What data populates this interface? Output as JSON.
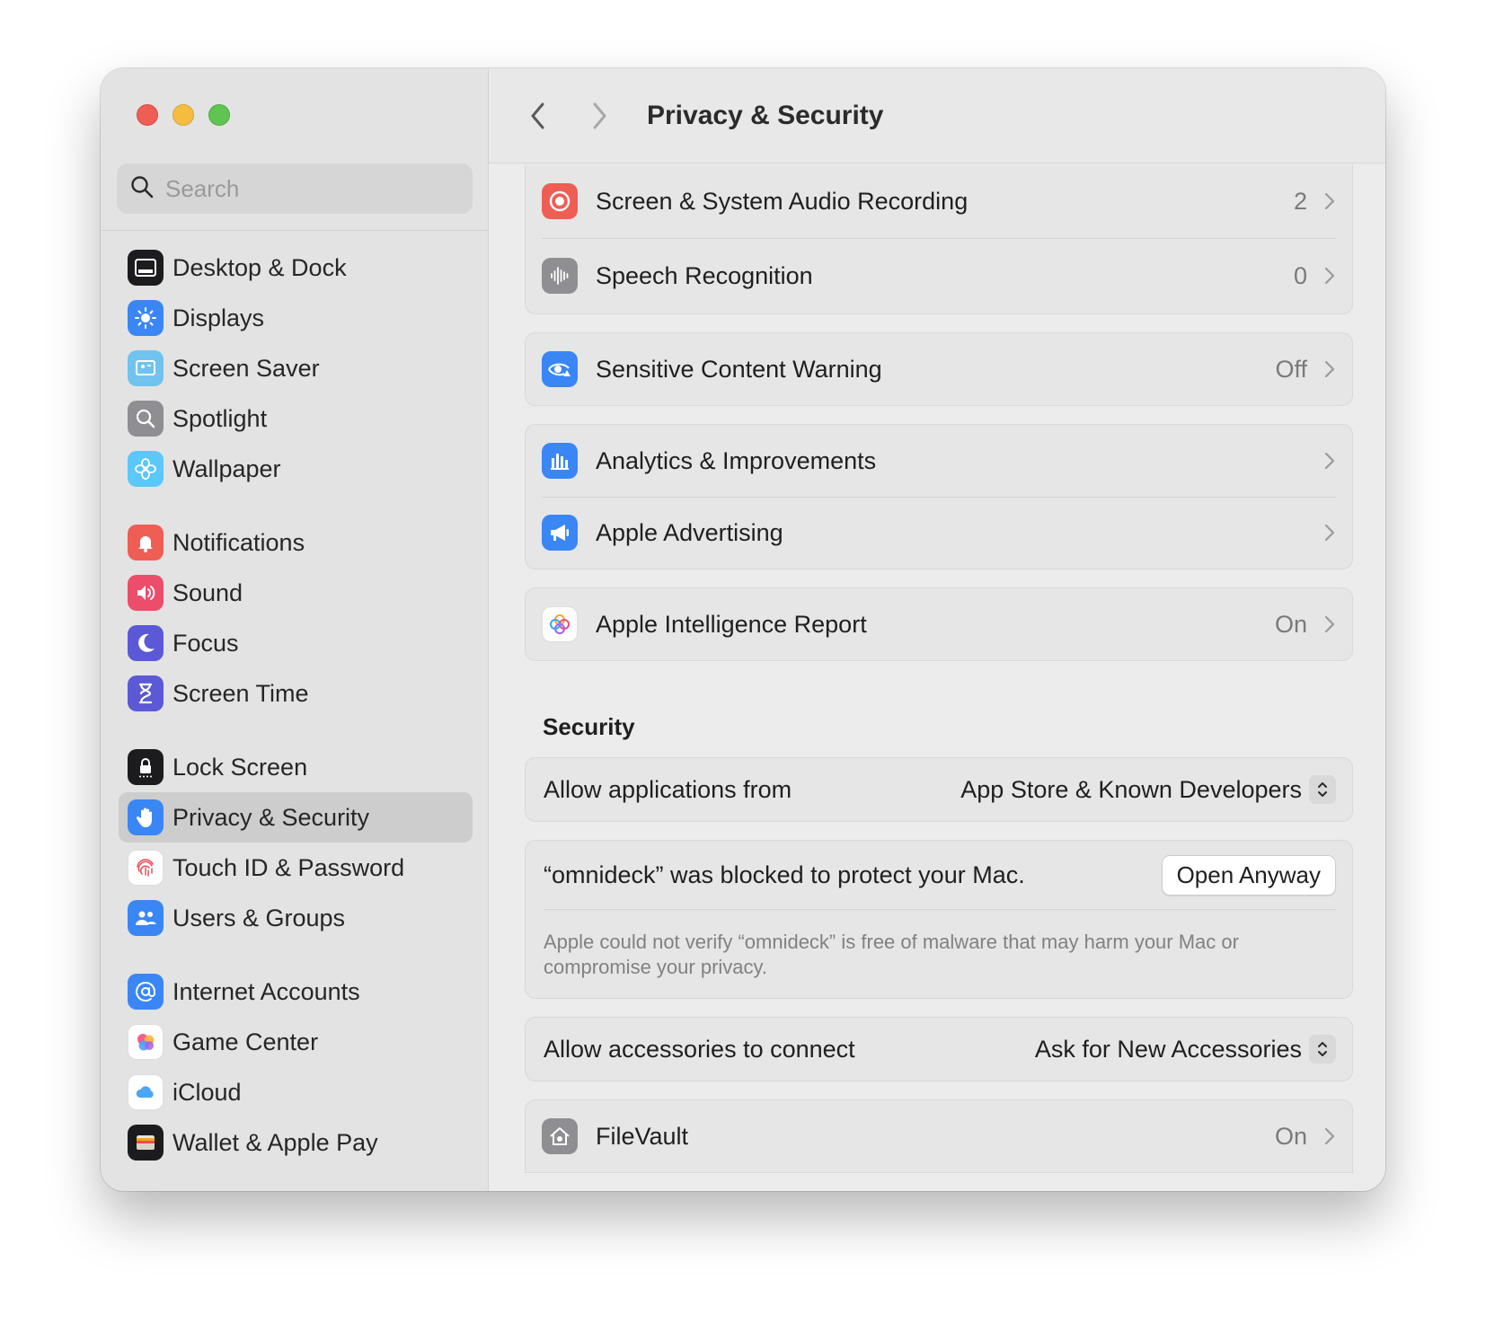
{
  "window": {
    "title": "Privacy & Security"
  },
  "search": {
    "placeholder": "Search"
  },
  "sidebar": {
    "groups": [
      [
        {
          "label": "Desktop & Dock",
          "icon": "dock-icon"
        },
        {
          "label": "Displays",
          "icon": "sun-icon"
        },
        {
          "label": "Screen Saver",
          "icon": "screen-saver-icon"
        },
        {
          "label": "Spotlight",
          "icon": "magnifier-icon"
        },
        {
          "label": "Wallpaper",
          "icon": "flower-icon"
        }
      ],
      [
        {
          "label": "Notifications",
          "icon": "bell-icon"
        },
        {
          "label": "Sound",
          "icon": "speaker-icon"
        },
        {
          "label": "Focus",
          "icon": "moon-icon"
        },
        {
          "label": "Screen Time",
          "icon": "hourglass-icon"
        }
      ],
      [
        {
          "label": "Lock Screen",
          "icon": "lock-icon"
        },
        {
          "label": "Privacy & Security",
          "icon": "hand-icon",
          "selected": true
        },
        {
          "label": "Touch ID & Password",
          "icon": "fingerprint-icon"
        },
        {
          "label": "Users & Groups",
          "icon": "users-icon"
        }
      ],
      [
        {
          "label": "Internet Accounts",
          "icon": "at-icon"
        },
        {
          "label": "Game Center",
          "icon": "game-center-icon"
        },
        {
          "label": "iCloud",
          "icon": "cloud-icon"
        },
        {
          "label": "Wallet & Apple Pay",
          "icon": "wallet-icon"
        }
      ]
    ]
  },
  "privacy": {
    "screen_recording": {
      "label": "Screen & System Audio Recording",
      "value": "2"
    },
    "speech_recognition": {
      "label": "Speech Recognition",
      "value": "0"
    },
    "sensitive_content": {
      "label": "Sensitive Content Warning",
      "value": "Off"
    },
    "analytics": {
      "label": "Analytics & Improvements"
    },
    "advertising": {
      "label": "Apple Advertising"
    },
    "intelligence_report": {
      "label": "Apple Intelligence Report",
      "value": "On"
    }
  },
  "security": {
    "section_title": "Security",
    "allow_apps": {
      "label": "Allow applications from",
      "value": "App Store & Known Developers"
    },
    "blocked": {
      "message": "“omnideck” was blocked to protect your Mac.",
      "button": "Open Anyway",
      "description": "Apple could not verify “omnideck” is free of malware that may harm your Mac or compromise your privacy."
    },
    "accessories": {
      "label": "Allow accessories to connect",
      "value": "Ask for New Accessories"
    },
    "filevault": {
      "label": "FileVault",
      "value": "On"
    }
  },
  "colors": {
    "red": "#ee5e55",
    "yellow": "#f5bd3f",
    "green": "#5fc451",
    "accent_blue": "#3a86f5"
  }
}
